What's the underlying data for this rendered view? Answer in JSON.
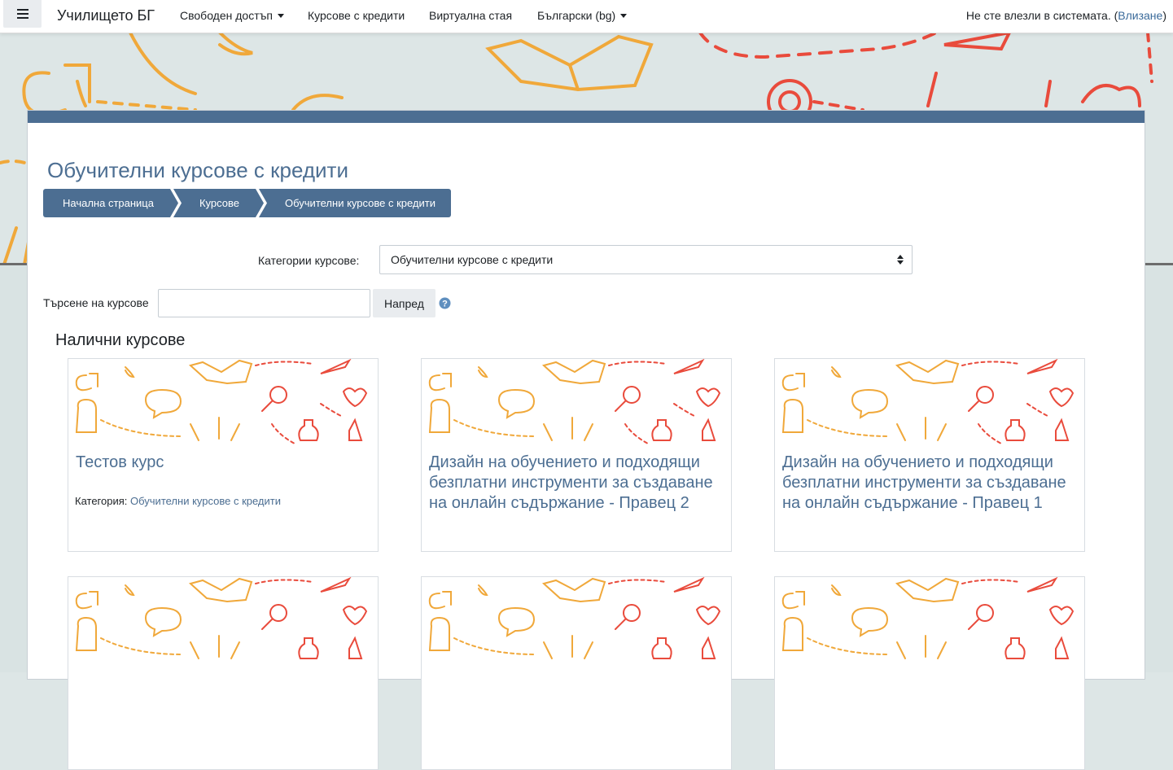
{
  "navbar": {
    "brand": "Училището БГ",
    "free_access": "Свободен достъп",
    "credit_courses": "Курсове с кредити",
    "virtual_room": "Виртуална стая",
    "language": "Български (bg)",
    "not_logged_in": "Не сте влезли в системата. (",
    "login_link": "Влизане",
    "login_close": ")"
  },
  "page": {
    "title": "Обучителни курсове с кредити",
    "breadcrumb": [
      "Начална страница",
      "Курсове",
      "Обучителни курсове с кредити"
    ]
  },
  "filters": {
    "category_label": "Категории курсове:",
    "category_value": "Обучителни курсове с кредити",
    "search_label": "Търсене на курсове",
    "search_value": "",
    "search_button": "Напред"
  },
  "courses": {
    "heading": "Налични курсове",
    "items": [
      {
        "name": "Тестов курс",
        "category_label": "Категория:",
        "category": "Обучителни курсове с кредити"
      },
      {
        "name": "Дизайн на обучението и подходящи безплатни инструменти за създаване на онлайн съдържание - Правец 2"
      },
      {
        "name": "Дизайн на обучението и подходящи безплатни инструменти за създаване на онлайн съдържание - Правец 1"
      }
    ]
  },
  "colors": {
    "primary": "#4c6e92",
    "orange": "#f0a83a",
    "red": "#e94b3c",
    "band": "#dde6e6"
  },
  "icons": [
    "hamburger-icon",
    "caret-down-icon",
    "help-icon",
    "select-arrows-icon"
  ]
}
